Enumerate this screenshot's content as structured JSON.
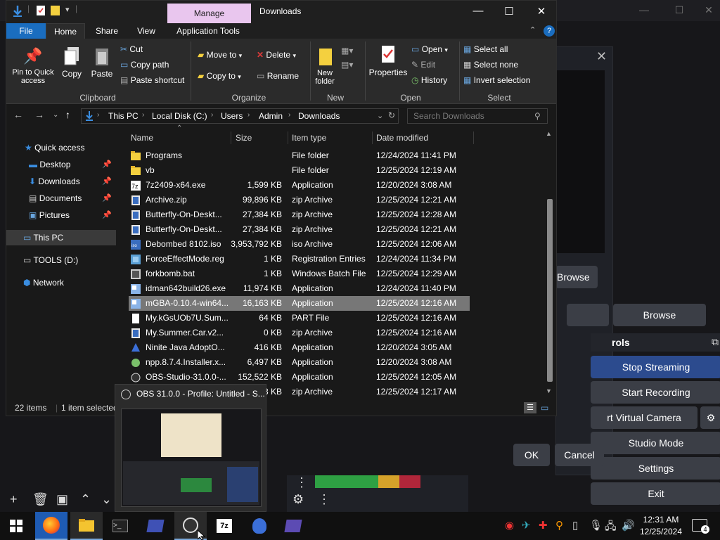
{
  "explorer": {
    "context_tab": "Manage",
    "title": "Downloads",
    "tabs": [
      "File",
      "Home",
      "Share",
      "View",
      "Application Tools"
    ],
    "ribbon": {
      "pin_to_quick_access": "Pin to Quick access",
      "copy": "Copy",
      "paste": "Paste",
      "cut": "Cut",
      "copy_path": "Copy path",
      "paste_shortcut": "Paste shortcut",
      "move_to": "Move to",
      "copy_to": "Copy to",
      "delete": "Delete",
      "rename": "Rename",
      "new_folder": "New folder",
      "properties": "Properties",
      "open": "Open",
      "edit": "Edit",
      "history": "History",
      "select_all": "Select all",
      "select_none": "Select none",
      "invert_selection": "Invert selection",
      "groups": [
        "Clipboard",
        "Organize",
        "New",
        "Open",
        "Select"
      ]
    },
    "breadcrumb": [
      "This PC",
      "Local Disk (C:)",
      "Users",
      "Admin",
      "Downloads"
    ],
    "search_placeholder": "Search Downloads",
    "nav": {
      "quick_access": "Quick access",
      "desktop": "Desktop",
      "downloads": "Downloads",
      "documents": "Documents",
      "pictures": "Pictures",
      "this_pc": "This PC",
      "tools": "TOOLS (D:)",
      "network": "Network"
    },
    "columns": [
      "Name",
      "Size",
      "Item type",
      "Date modified"
    ],
    "files": [
      {
        "name": "Programs",
        "size": "",
        "type": "File folder",
        "date": "12/24/2024 11:41 PM",
        "icon": "folder"
      },
      {
        "name": "vb",
        "size": "",
        "type": "File folder",
        "date": "12/25/2024 12:19 AM",
        "icon": "folder"
      },
      {
        "name": "7z2409-x64.exe",
        "size": "1,599 KB",
        "type": "Application",
        "date": "12/20/2024 3:08 AM",
        "icon": "7z"
      },
      {
        "name": "Archive.zip",
        "size": "99,896 KB",
        "type": "zip Archive",
        "date": "12/25/2024 12:21 AM",
        "icon": "zip"
      },
      {
        "name": "Butterfly-On-Deskt...",
        "size": "27,384 KB",
        "type": "zip Archive",
        "date": "12/25/2024 12:28 AM",
        "icon": "zip"
      },
      {
        "name": "Butterfly-On-Deskt...",
        "size": "27,384 KB",
        "type": "zip Archive",
        "date": "12/25/2024 12:21 AM",
        "icon": "zip"
      },
      {
        "name": "Debombed 8102.iso",
        "size": "3,953,792 KB",
        "type": "iso Archive",
        "date": "12/25/2024 12:06 AM",
        "icon": "iso"
      },
      {
        "name": "ForceEffectMode.reg",
        "size": "1 KB",
        "type": "Registration Entries",
        "date": "12/24/2024 11:34 PM",
        "icon": "reg"
      },
      {
        "name": "forkbomb.bat",
        "size": "1 KB",
        "type": "Windows Batch File",
        "date": "12/25/2024 12:29 AM",
        "icon": "bat"
      },
      {
        "name": "idman642build26.exe",
        "size": "11,974 KB",
        "type": "Application",
        "date": "12/24/2024 11:40 PM",
        "icon": "exe"
      },
      {
        "name": "mGBA-0.10.4-win64...",
        "size": "16,163 KB",
        "type": "Application",
        "date": "12/25/2024 12:16 AM",
        "icon": "exe"
      },
      {
        "name": "My.kGsUOb7U.Sum...",
        "size": "64 KB",
        "type": "PART File",
        "date": "12/25/2024 12:16 AM",
        "icon": "file"
      },
      {
        "name": "My.Summer.Car.v2...",
        "size": "0 KB",
        "type": "zip Archive",
        "date": "12/25/2024 12:16 AM",
        "icon": "zip"
      },
      {
        "name": "Ninite Java AdoptO...",
        "size": "416 KB",
        "type": "Application",
        "date": "12/20/2024 3:05 AM",
        "icon": "ninite"
      },
      {
        "name": "npp.8.7.4.Installer.x...",
        "size": "6,497 KB",
        "type": "Application",
        "date": "12/20/2024 3:08 AM",
        "icon": "npp"
      },
      {
        "name": "OBS-Studio-31.0.0-...",
        "size": "152,522 KB",
        "type": "Application",
        "date": "12/25/2024 12:05 AM",
        "icon": "obs"
      },
      {
        "name": "",
        "size": "3 KB",
        "type": "zip Archive",
        "date": "12/25/2024 12:17 AM",
        "icon": "zip"
      }
    ],
    "selected_row": 10,
    "status": {
      "count": "22 items",
      "selected": "1 item selected"
    }
  },
  "obs": {
    "browse_1": "Browse",
    "browse_2": "Browse",
    "controls_header": "rols",
    "stop_streaming": "Stop Streaming",
    "start_recording": "Start Recording",
    "virtual_camera": "rt Virtual Camera",
    "studio_mode": "Studio Mode",
    "settings": "Settings",
    "exit": "Exit",
    "ok": "OK",
    "cancel": "Cancel",
    "thumbnail_title": "OBS 31.0.0 - Profile: Untitled - S..."
  },
  "taskbar": {
    "time": "12:31 AM",
    "date": "12/25/2024",
    "notification_count": "4"
  },
  "colors": {
    "accent": "#1a6dbf",
    "context_tab": "#e9c6ee",
    "obs_active": "#2c4b8e"
  }
}
